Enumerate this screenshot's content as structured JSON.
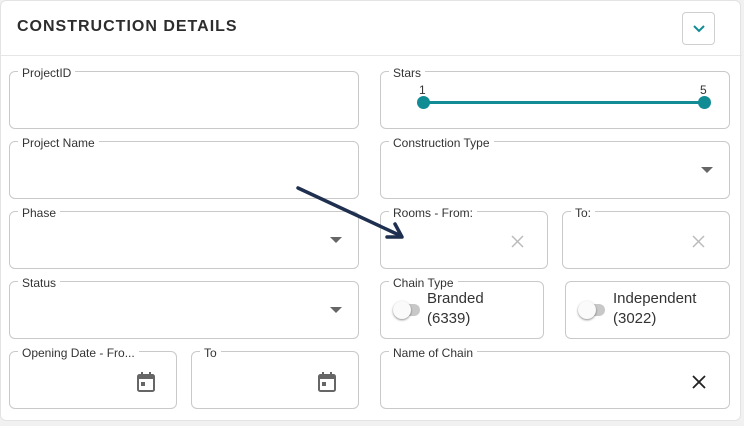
{
  "header": {
    "title": "CONSTRUCTION DETAILS",
    "collapse_icon": "chevron-down-icon"
  },
  "fields": {
    "project_id": {
      "label": "ProjectID",
      "value": ""
    },
    "project_name": {
      "label": "Project Name",
      "value": ""
    },
    "phase": {
      "label": "Phase",
      "value": ""
    },
    "status": {
      "label": "Status",
      "value": ""
    },
    "opening_date_from": {
      "label": "Opening Date - Fro...",
      "value": ""
    },
    "opening_date_to": {
      "label": "To",
      "value": ""
    },
    "stars": {
      "label": "Stars",
      "min": "1",
      "max": "5"
    },
    "construction_type": {
      "label": "Construction Type",
      "value": ""
    },
    "rooms_from": {
      "label": "Rooms - From:",
      "value": ""
    },
    "rooms_to": {
      "label": "To:",
      "value": ""
    },
    "chain_type": {
      "label": "Chain Type",
      "branded": {
        "label": "Branded",
        "count": "(6339)"
      },
      "independent": {
        "label": "Independent",
        "count": "(3022)"
      }
    },
    "name_of_chain": {
      "label": "Name of Chain",
      "value": ""
    }
  },
  "colors": {
    "accent": "#128c94",
    "annotation_arrow": "#1f2f4f"
  }
}
